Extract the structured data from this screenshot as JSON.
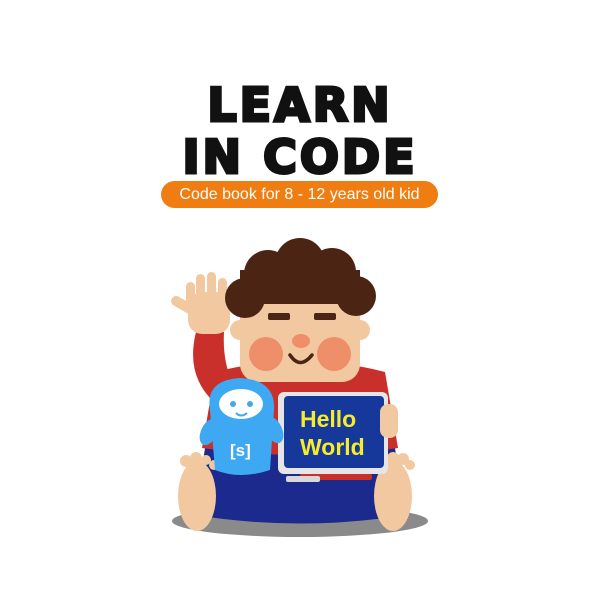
{
  "title": {
    "line1": "LEARN",
    "line2": "IN CODE"
  },
  "subtitle": "Code book for 8 - 12 years old kid",
  "tablet": {
    "line1": "Hello",
    "line2": "World"
  },
  "mascot": {
    "badge": "[s]"
  },
  "colors": {
    "accent": "#f07d12",
    "title": "#111111",
    "tablet_screen": "#16389a",
    "tablet_text": "#f7ec2a",
    "shirt": "#c9302c",
    "pants": "#1b2a8c",
    "hair": "#4b2413",
    "skin": "#f2c8a0",
    "mascot": "#3ea9f2"
  }
}
